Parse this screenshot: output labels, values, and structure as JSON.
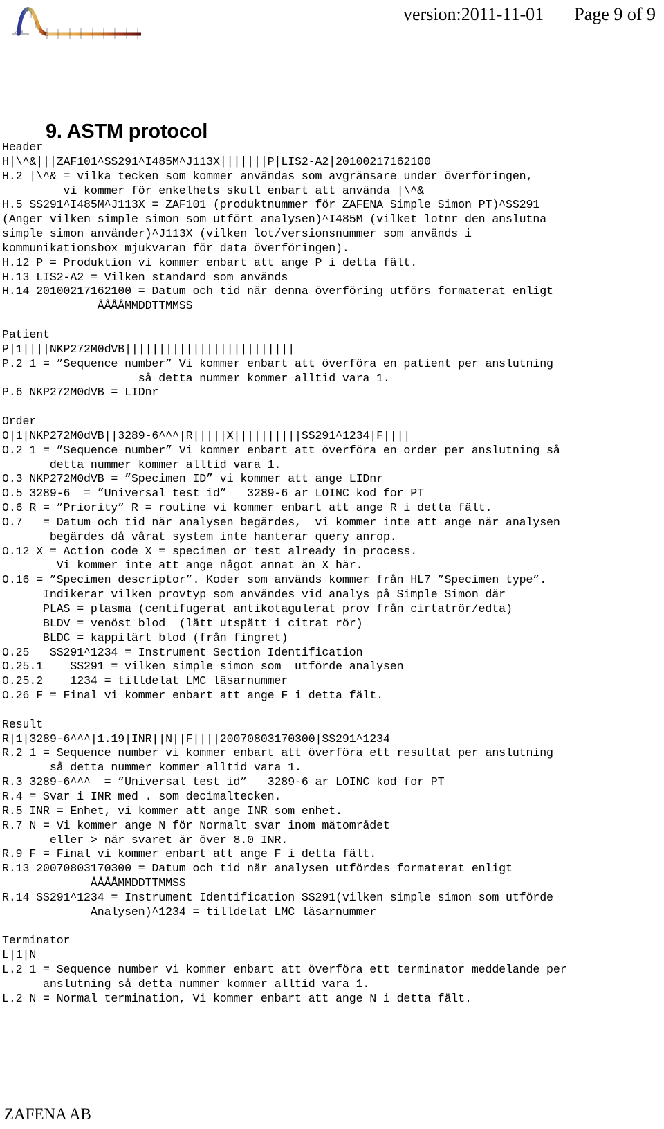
{
  "header": {
    "version_label": "version:2011-11-01",
    "page_label": "Page 9 of 9",
    "logo_alt": "zafena-curve-logo"
  },
  "title": "9. ASTM protocol",
  "footer": {
    "company": "ZAFENA AB"
  },
  "body": {
    "lines": [
      "Header",
      "H|\\^&|||ZAF101^SS291^I485M^J113X|||||||P|LIS2-A2|20100217162100",
      "H.2 |\\^& = vilka tecken som kommer användas som avgränsare under överföringen,",
      "         vi kommer för enkelhets skull enbart att använda |\\^&",
      "H.5 SS291^I485M^J113X = ZAF101 (produktnummer för ZAFENA Simple Simon PT)^SS291",
      "(Anger vilken simple simon som utfört analysen)^I485M (vilket lotnr den anslutna",
      "simple simon använder)^J113X (vilken lot/versionsnummer som används i",
      "kommunikationsbox mjukvaran för data överföringen).",
      "H.12 P = Produktion vi kommer enbart att ange P i detta fält.",
      "H.13 LIS2-A2 = Vilken standard som används",
      "H.14 20100217162100 = Datum och tid när denna överföring utförs formaterat enligt",
      "              ÅÅÅÅMMDDTTMMSS",
      "",
      "Patient",
      "P|1||||NKP272M0dVB|||||||||||||||||||||||||",
      "P.2 1 = ”Sequence number” Vi kommer enbart att överföra en patient per anslutning",
      "                    så detta nummer kommer alltid vara 1.",
      "P.6 NKP272M0dVB = LIDnr",
      "",
      "Order",
      "O|1|NKP272M0dVB||3289-6^^^|R|||||X||||||||||SS291^1234|F||||",
      "O.2 1 = ”Sequence number” Vi kommer enbart att överföra en order per anslutning så",
      "       detta nummer kommer alltid vara 1.",
      "O.3 NKP272M0dVB = ”Specimen ID” vi kommer att ange LIDnr",
      "O.5 3289-6  = ”Universal test id”   3289-6 ar LOINC kod for PT",
      "O.6 R = ”Priority” R = routine vi kommer enbart att ange R i detta fält.",
      "O.7   = Datum och tid när analysen begärdes,  vi kommer inte att ange när analysen",
      "       begärdes då vårat system inte hanterar query anrop.",
      "O.12 X = Action code X = specimen or test already in process.",
      "        Vi kommer inte att ange något annat än X här.",
      "O.16 = ”Specimen descriptor”. Koder som används kommer från HL7 ”Specimen type”.",
      "      Indikerar vilken provtyp som användes vid analys på Simple Simon där",
      "      PLAS = plasma (centifugerat antikotagulerat prov från cirtatrör/edta)",
      "      BLDV = venöst blod  (lätt utspätt i citrat rör)",
      "      BLDC = kappilärt blod (från fingret)",
      "O.25   SS291^1234 = Instrument Section Identification",
      "O.25.1    SS291 = vilken simple simon som  utförde analysen",
      "O.25.2    1234 = tilldelat LMC läsarnummer",
      "O.26 F = Final vi kommer enbart att ange F i detta fält.",
      "",
      "Result",
      "R|1|3289-6^^^|1.19|INR||N||F||||20070803170300|SS291^1234",
      "R.2 1 = Sequence number vi kommer enbart att överföra ett resultat per anslutning",
      "       så detta nummer kommer alltid vara 1.",
      "R.3 3289-6^^^  = ”Universal test id”   3289-6 ar LOINC kod for PT",
      "R.4 = Svar i INR med . som decimaltecken.",
      "R.5 INR = Enhet, vi kommer att ange INR som enhet.",
      "R.7 N = Vi kommer ange N för Normalt svar inom mätområdet",
      "       eller > när svaret är över 8.0 INR.",
      "R.9 F = Final vi kommer enbart att ange F i detta fält.",
      "R.13 20070803170300 = Datum och tid när analysen utfördes formaterat enligt",
      "             ÅÅÅÅMMDDTTMMSS",
      "R.14 SS291^1234 = Instrument Identification SS291(vilken simple simon som utförde",
      "             Analysen)^1234 = tilldelat LMC läsarnummer",
      "",
      "Terminator",
      "L|1|N",
      "L.2 1 = Sequence number vi kommer enbart att överföra ett terminator meddelande per",
      "      anslutning så detta nummer kommer alltid vara 1.",
      "L.2 N = Normal termination, Vi kommer enbart att ange N i detta fält."
    ]
  }
}
